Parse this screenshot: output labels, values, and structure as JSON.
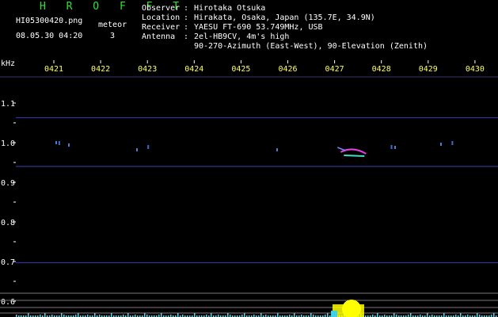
{
  "header": {
    "brand": "H R O F F T",
    "filename": "HI05300420.png",
    "datetime": "08.05.30 04:20",
    "counter_label": "meteor",
    "counter_value": "3",
    "info_labels": [
      "Observer",
      "Location",
      "Receiver",
      "Antenna",
      ""
    ],
    "info_values": [
      "Hirotaka Otsuka",
      "Hirakata, Osaka, Japan (135.7E, 34.9N)",
      "YAESU FT-690 53.749MHz, USB",
      "2el-HB9CV, 4m's high",
      "90-270-Azimuth (East-West), 90-Elevation (Zenith)"
    ]
  },
  "colors": {
    "background": "#000000",
    "text": "#ffffff",
    "brand": "#32e032",
    "time_labels": "#ffff66",
    "trace": "#3a3aa0",
    "meteor": "#e040e0",
    "noise": "#55d8e8",
    "burst": "#ffff00"
  },
  "chart_data": {
    "type": "heatmap",
    "ylabel": "kHz",
    "time_ticks": [
      "0421",
      "0422",
      "0423",
      "0424",
      "0425",
      "0426",
      "0427",
      "0428",
      "0429",
      "0430"
    ],
    "freq_ticks": [
      "1.1",
      "1.0",
      "0.9",
      "0.8",
      "0.7",
      "0.6"
    ],
    "ylim": [
      0.58,
      1.15
    ],
    "horizontal_traces_khz": [
      1.063,
      0.94,
      0.697
    ],
    "meteor_echoes": [
      {
        "time": "0427.3",
        "freq_khz": 0.98,
        "strength": "strong"
      },
      {
        "time": "0421.1",
        "freq_khz": 1.0,
        "strength": "weak"
      },
      {
        "time": "0423.0",
        "freq_khz": 0.99,
        "strength": "weak"
      },
      {
        "time": "0428.2",
        "freq_khz": 0.99,
        "strength": "weak"
      },
      {
        "time": "0429.5",
        "freq_khz": 1.0,
        "strength": "weak"
      }
    ]
  }
}
